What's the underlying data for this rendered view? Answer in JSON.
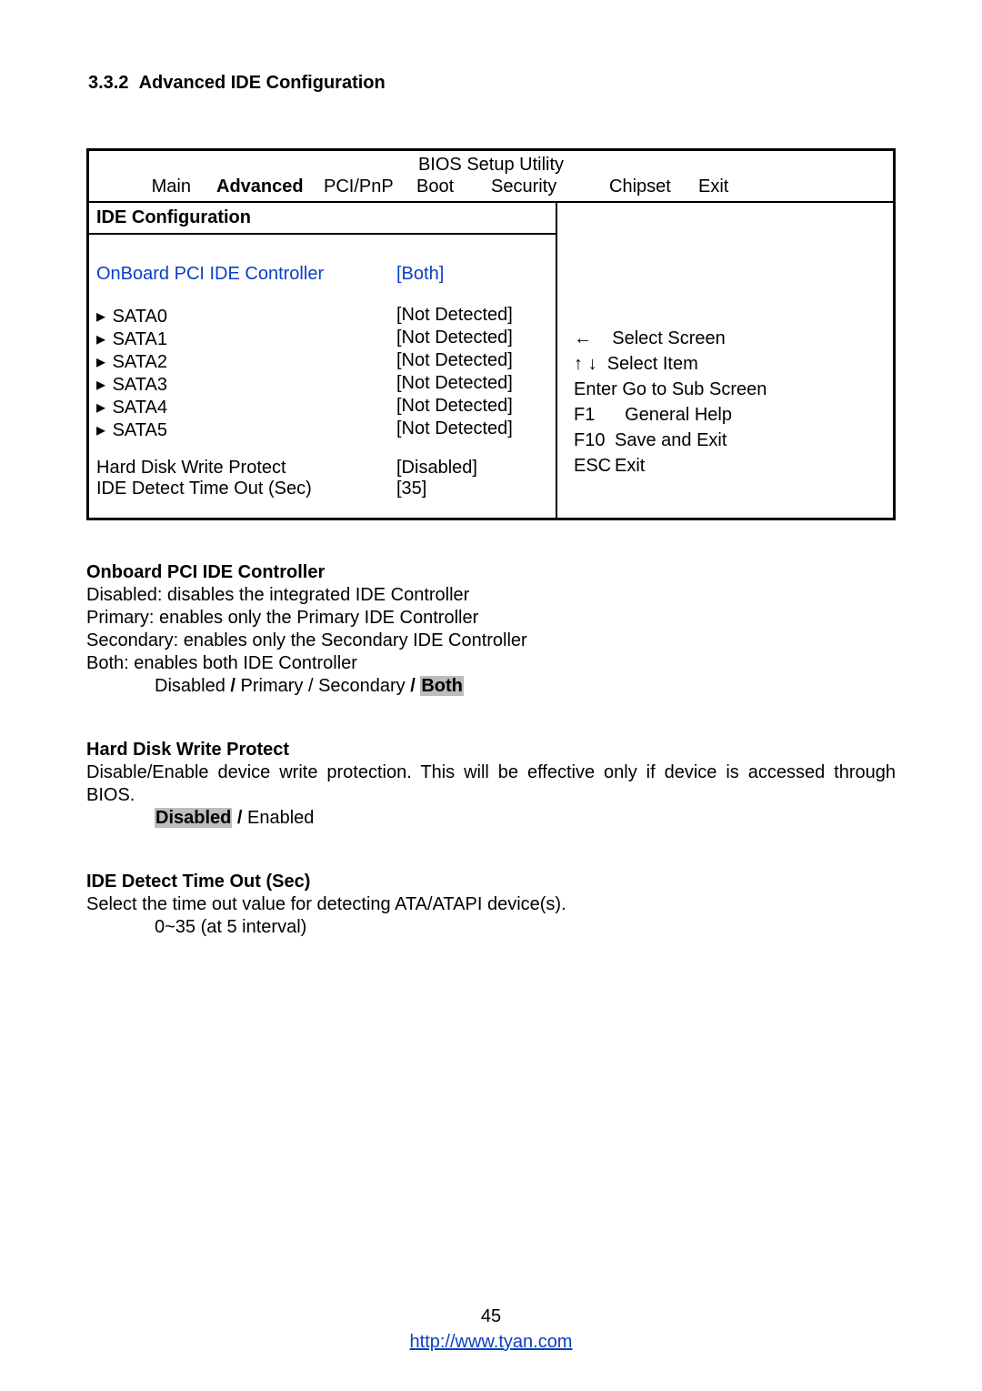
{
  "section_number": "3.3.2",
  "section_title": "Advanced IDE Configuration",
  "bios": {
    "title": "BIOS Setup Utility",
    "tabs": {
      "main": "Main",
      "advanced": "Advanced",
      "pcipnp": "PCI/PnP",
      "boot": "Boot",
      "security": "Security",
      "chipset": "Chipset",
      "exit": "Exit"
    },
    "panel_title": "IDE Configuration",
    "selected": {
      "label": "OnBoard PCI IDE Controller",
      "value": "[Both]"
    },
    "sata": [
      {
        "label": "SATA0",
        "value": "[Not Detected]"
      },
      {
        "label": "SATA1",
        "value": "[Not Detected]"
      },
      {
        "label": "SATA2",
        "value": "[Not Detected]"
      },
      {
        "label": "SATA3",
        "value": "[Not Detected]"
      },
      {
        "label": "SATA4",
        "value": "[Not Detected]"
      },
      {
        "label": "SATA5",
        "value": "[Not Detected]"
      }
    ],
    "hdwp": {
      "label": "Hard Disk Write Protect",
      "value": "[Disabled]"
    },
    "timeout": {
      "label": "IDE Detect Time Out (Sec)",
      "value": "[35]"
    },
    "help": {
      "select_screen": "Select Screen",
      "select_item": "Select Item",
      "enter_sub": "Enter Go to Sub Screen",
      "f1": "F1",
      "f1_text": "General Help",
      "f10": "F10",
      "f10_text": "Save and Exit",
      "esc": "ESC",
      "esc_text": "Exit"
    }
  },
  "desc": {
    "ide_ctrl": {
      "heading": "Onboard PCI IDE Controller",
      "line1": "Disabled: disables the integrated IDE Controller",
      "line2": "Primary: enables only the Primary IDE Controller",
      "line3": "Secondary: enables only the Secondary IDE Controller",
      "line4": "Both: enables both IDE Controller",
      "opts_disabled": "Disabled",
      "opts_primary": "Primary",
      "opts_secondary": "Secondary",
      "opts_both": "Both",
      "slash": " / "
    },
    "hdwp": {
      "heading": "Hard Disk Write Protect",
      "text": "Disable/Enable device write protection. This will be effective only if device is accessed through BIOS.",
      "opt_disabled": "Disabled",
      "opt_enabled": "Enabled",
      "slash": " / "
    },
    "timeout": {
      "heading": "IDE Detect Time Out (Sec)",
      "text": "Select the time out value for detecting ATA/ATAPI device(s).",
      "range": "0~35 (at 5 interval)"
    }
  },
  "footer": {
    "page": "45",
    "url": "http://www.tyan.com"
  }
}
